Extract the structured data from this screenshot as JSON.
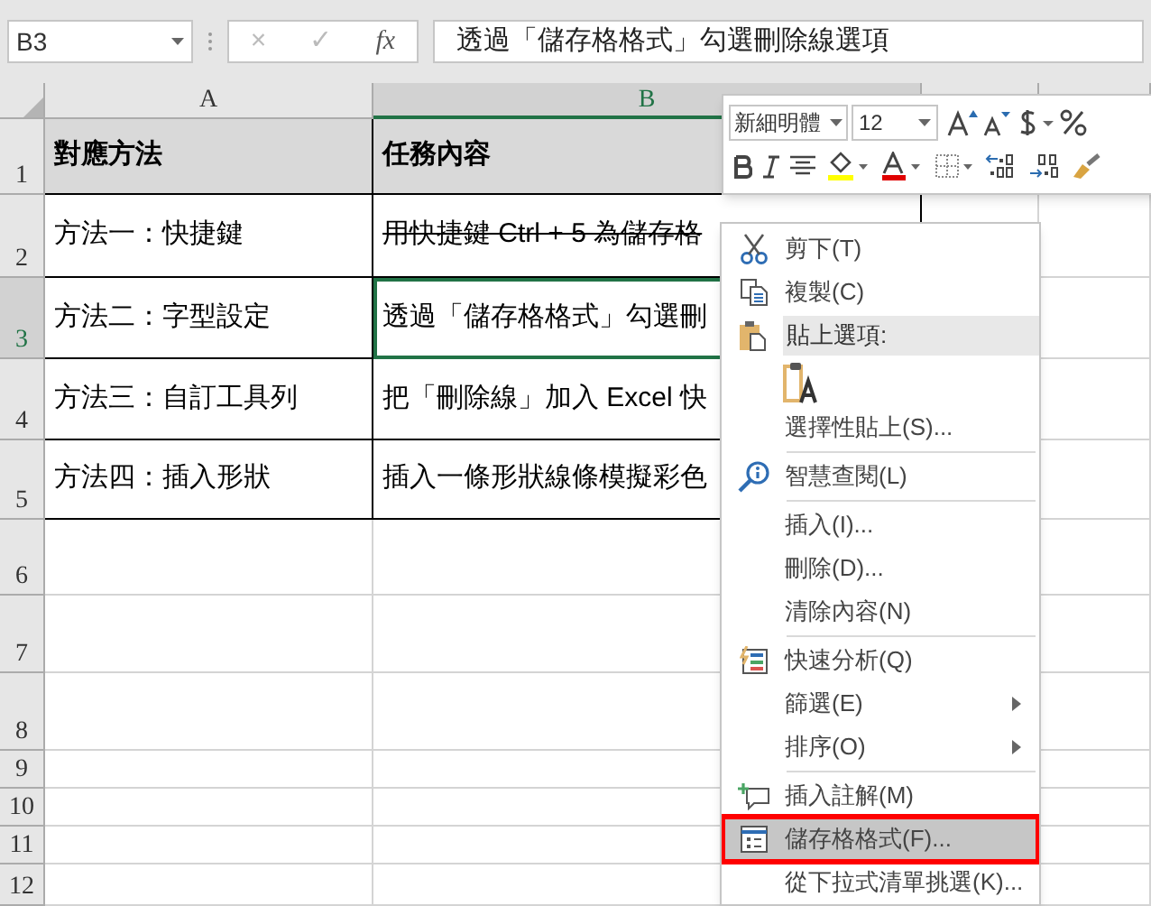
{
  "formula_bar": {
    "name_box": "B3",
    "cancel": "×",
    "enter": "✓",
    "fx": "fx",
    "formula": "透過「儲存格格式」勾選刪除線選項"
  },
  "columns": [
    {
      "label": "A",
      "selected": false
    },
    {
      "label": "B",
      "selected": true
    },
    {
      "selected": false
    },
    {
      "selected": false
    }
  ],
  "rows": [
    {
      "number": "1",
      "selected": false,
      "header": true,
      "cells": [
        {
          "text": "對應方法",
          "strikethrough": false
        },
        {
          "text": "任務內容",
          "strikethrough": false
        }
      ]
    },
    {
      "number": "2",
      "selected": false,
      "header": false,
      "cells": [
        {
          "text": "方法一：快捷鍵",
          "strikethrough": false
        },
        {
          "text": "用快捷鍵 Ctrl + 5 為儲存格",
          "strikethrough": true
        }
      ]
    },
    {
      "number": "3",
      "selected": true,
      "header": false,
      "cells": [
        {
          "text": "方法二：字型設定",
          "strikethrough": false
        },
        {
          "text": "透過「儲存格格式」勾選刪",
          "strikethrough": false
        }
      ]
    },
    {
      "number": "4",
      "selected": false,
      "header": false,
      "cells": [
        {
          "text": "方法三：自訂工具列",
          "strikethrough": false
        },
        {
          "text": "把「刪除線」加入 Excel 快",
          "strikethrough": false
        }
      ]
    },
    {
      "number": "5",
      "selected": false,
      "header": false,
      "cells": [
        {
          "text": "方法四：插入形狀",
          "strikethrough": false
        },
        {
          "text": "插入一條形狀線條模擬彩色",
          "strikethrough": false
        }
      ]
    },
    {
      "number": "6",
      "selected": false,
      "header": false,
      "cells": []
    },
    {
      "number": "7",
      "selected": false,
      "header": false,
      "cells": []
    },
    {
      "number": "8",
      "selected": false,
      "header": false,
      "cells": []
    },
    {
      "number": "9",
      "selected": false,
      "header": false,
      "cells": []
    },
    {
      "number": "10",
      "selected": false,
      "header": false,
      "cells": []
    },
    {
      "number": "11",
      "selected": false,
      "header": false,
      "cells": []
    },
    {
      "number": "12",
      "selected": false,
      "header": false,
      "cells": []
    }
  ],
  "mini_toolbar": {
    "font": "新細明體",
    "size": "12"
  },
  "context_menu": {
    "groups": [
      [
        {
          "kind": "item",
          "label": "剪下(T)",
          "submenu": false,
          "selected": false
        },
        {
          "kind": "item",
          "label": "複製(C)",
          "submenu": false,
          "selected": false
        },
        {
          "kind": "section",
          "label": "貼上選項:"
        },
        {
          "kind": "paste_option"
        },
        {
          "kind": "item",
          "label": "選擇性貼上(S)...",
          "submenu": false,
          "selected": false
        }
      ],
      [
        {
          "kind": "item",
          "label": "智慧查閱(L)",
          "submenu": false,
          "selected": false
        }
      ],
      [
        {
          "kind": "item",
          "label": "插入(I)...",
          "submenu": false,
          "selected": false
        },
        {
          "kind": "item",
          "label": "刪除(D)...",
          "submenu": false,
          "selected": false
        },
        {
          "kind": "item",
          "label": "清除內容(N)",
          "submenu": false,
          "selected": false
        }
      ],
      [
        {
          "kind": "item",
          "label": "快速分析(Q)",
          "submenu": false,
          "selected": false
        },
        {
          "kind": "item",
          "label": "篩選(E)",
          "submenu": true,
          "selected": false
        },
        {
          "kind": "item",
          "label": "排序(O)",
          "submenu": true,
          "selected": false
        }
      ],
      [
        {
          "kind": "item",
          "label": "插入註解(M)",
          "submenu": false,
          "selected": false
        },
        {
          "kind": "item",
          "label": "儲存格格式(F)...",
          "submenu": false,
          "selected": true
        },
        {
          "kind": "item",
          "label": "從下拉式清單挑選(K)...",
          "submenu": false,
          "selected": false
        }
      ]
    ]
  }
}
